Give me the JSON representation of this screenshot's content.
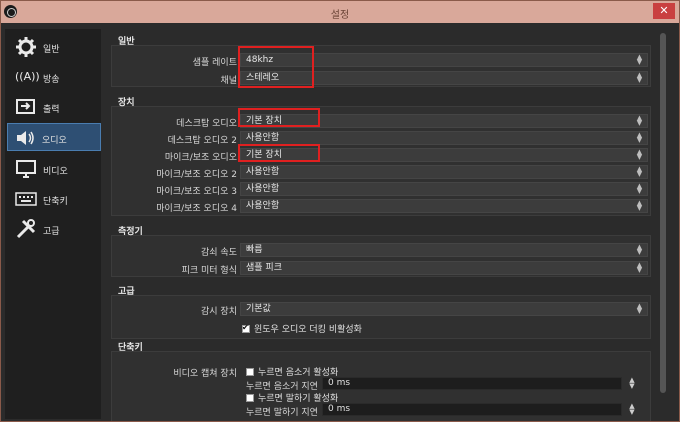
{
  "window": {
    "title": "설정",
    "close_label": "✕"
  },
  "sidebar": {
    "items": [
      {
        "label": "일반",
        "icon": "gear-icon"
      },
      {
        "label": "방송",
        "icon": "broadcast-icon"
      },
      {
        "label": "출력",
        "icon": "output-icon"
      },
      {
        "label": "오디오",
        "icon": "speaker-icon"
      },
      {
        "label": "비디오",
        "icon": "monitor-icon"
      },
      {
        "label": "단축키",
        "icon": "keyboard-icon"
      },
      {
        "label": "고급",
        "icon": "tools-icon"
      }
    ],
    "active_index": 3
  },
  "general": {
    "title": "일반",
    "sample_rate_label": "샘플 레이트",
    "sample_rate_value": "48khz",
    "channel_label": "채널",
    "channel_value": "스테레오"
  },
  "devices": {
    "title": "장치",
    "rows": [
      {
        "label": "데스크탑 오디오",
        "value": "기본 장치"
      },
      {
        "label": "데스크탑 오디오 2",
        "value": "사용안함"
      },
      {
        "label": "마이크/보조 오디오",
        "value": "기본 장치"
      },
      {
        "label": "마이크/보조 오디오 2",
        "value": "사용안함"
      },
      {
        "label": "마이크/보조 오디오 3",
        "value": "사용안함"
      },
      {
        "label": "마이크/보조 오디오 4",
        "value": "사용안함"
      }
    ]
  },
  "meters": {
    "title": "측정기",
    "decay_label": "감쇠 속도",
    "decay_value": "빠름",
    "peak_label": "피크 미터 형식",
    "peak_value": "샘플 피크"
  },
  "advanced": {
    "title": "고급",
    "monitor_label": "감시 장치",
    "monitor_value": "기본값",
    "ducking_label": "윈도우 오디오 더킹 비활성화",
    "ducking_checked": true
  },
  "hotkeys": {
    "title": "단축키",
    "video_capture_label": "비디오 캡쳐 장치",
    "ptt_mute_label": "누르면 음소거 활성화",
    "ptt_mute_delay_label": "누르면 음소거 지연",
    "ptt_mute_delay_value": "0 ms",
    "ptt_talk_label": "누르면 말하기 활성화",
    "ptt_talk_delay_label": "누르면 말하기 지연",
    "ptt_talk_delay_value": "0 ms"
  },
  "colors": {
    "titlebar": "#d9a89a",
    "active_sidebar": "#2e4f73",
    "highlight_box": "#e02020"
  }
}
